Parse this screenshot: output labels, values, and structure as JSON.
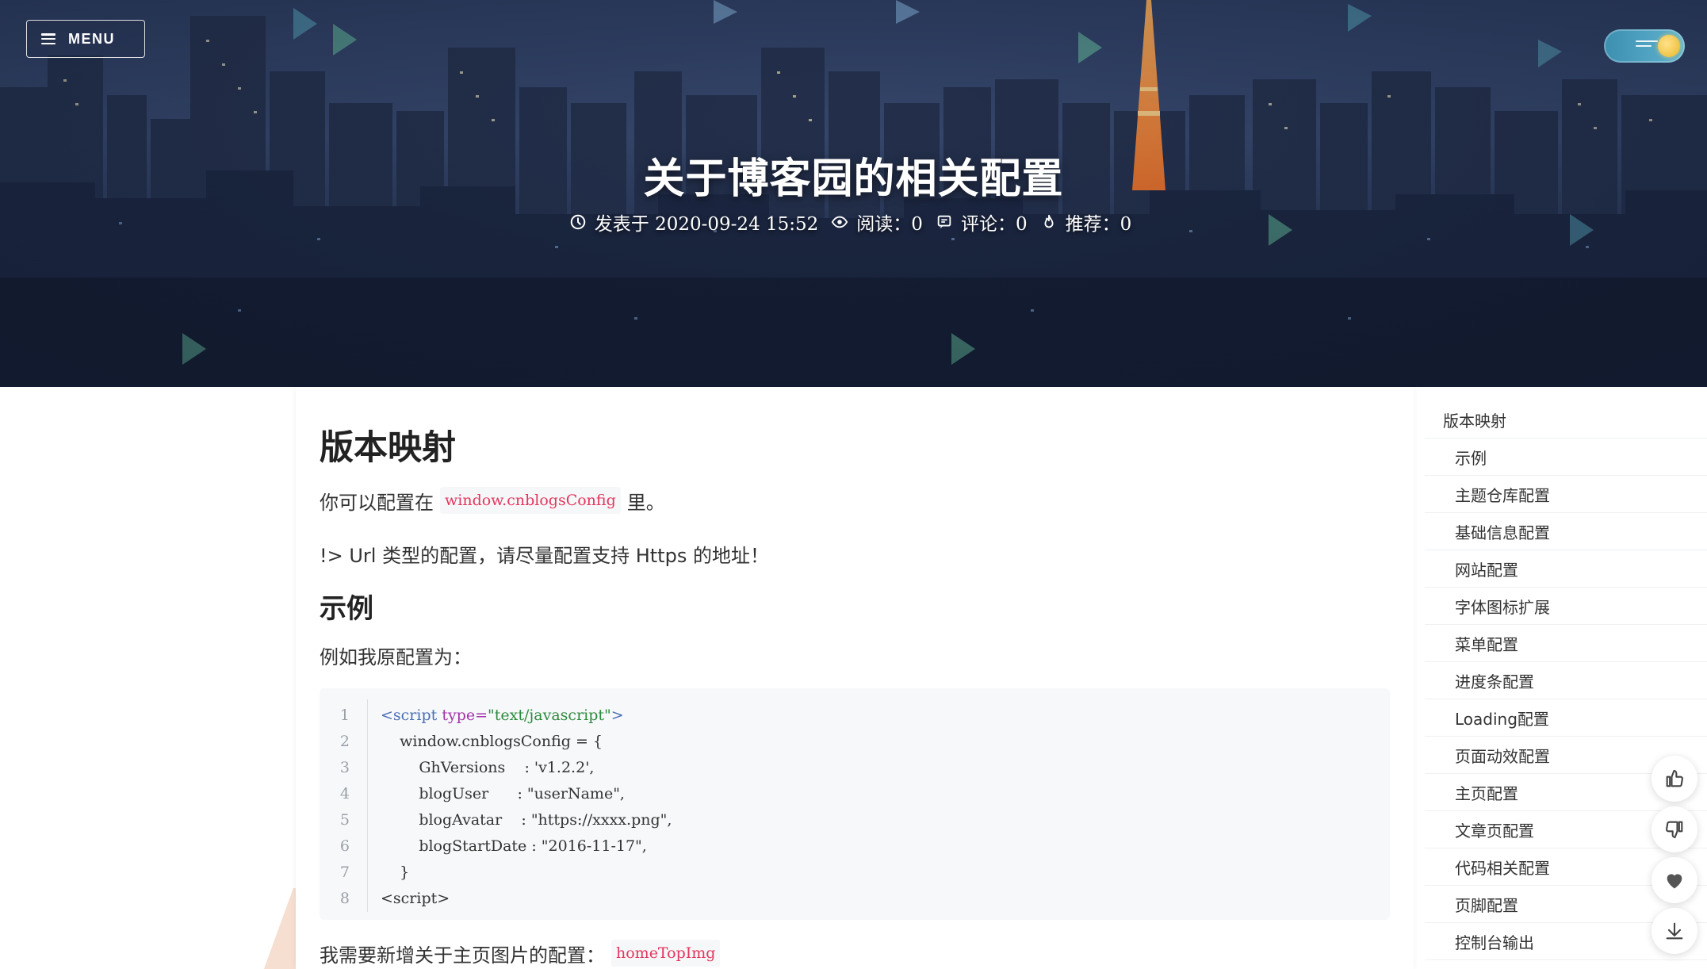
{
  "header": {
    "menu_label": "MENU",
    "title": "关于博客园的相关配置",
    "meta": {
      "posted": "发表于 2020-09-24 15:52",
      "reads": "阅读：0",
      "comments": "评论：0",
      "recommends": "推荐：0"
    },
    "icons": {
      "menu": "hamburger-icon",
      "theme_toggle": "day-night-toggle",
      "clock": "clock-icon",
      "eye": "eye-icon",
      "comment": "comment-icon",
      "fire": "fire-icon"
    }
  },
  "article": {
    "h1": "版本映射",
    "p1_before": "你可以配置在",
    "p1_code": "window.cnblogsConfig",
    "p1_after": "里。",
    "p2": "!> Url 类型的配置，请尽量配置支持 Https 的地址！",
    "h2": "示例",
    "p3": "例如我原配置为：",
    "code": {
      "line_numbers": [
        "1",
        "2",
        "3",
        "4",
        "5",
        "6",
        "7",
        "8"
      ],
      "l1_open": "<script",
      "l1_attr": " type=",
      "l1_str": "\"text/javascript\"",
      "l1_close": ">",
      "l2": "    window.cnblogsConfig = {",
      "l3": "        GhVersions    : 'v1.2.2',",
      "l4": "        blogUser      : \"userName\",",
      "l5": "        blogAvatar    : \"https://xxxx.png\",",
      "l6": "        blogStartDate : \"2016-11-17\",",
      "l7": "    }",
      "l8": "<script>"
    },
    "p4_before": "我需要新增关于主页图片的配置：",
    "p4_code": "homeTopImg"
  },
  "toc": {
    "items": [
      "版本映射",
      "示例",
      "主题仓库配置",
      "基础信息配置",
      "网站配置",
      "字体图标扩展",
      "菜单配置",
      "进度条配置",
      "Loading配置",
      "页面动效配置",
      "主页配置",
      "文章页配置",
      "代码相关配置",
      "页脚配置",
      "控制台输出"
    ]
  },
  "actions": {
    "icons": [
      "thumbs-up-icon",
      "thumbs-down-icon",
      "heart-icon",
      "download-icon"
    ]
  },
  "colors": {
    "inline_code": "#e3365d",
    "code_bg": "#f6f8fa",
    "toggle": "#4aa3c4"
  }
}
